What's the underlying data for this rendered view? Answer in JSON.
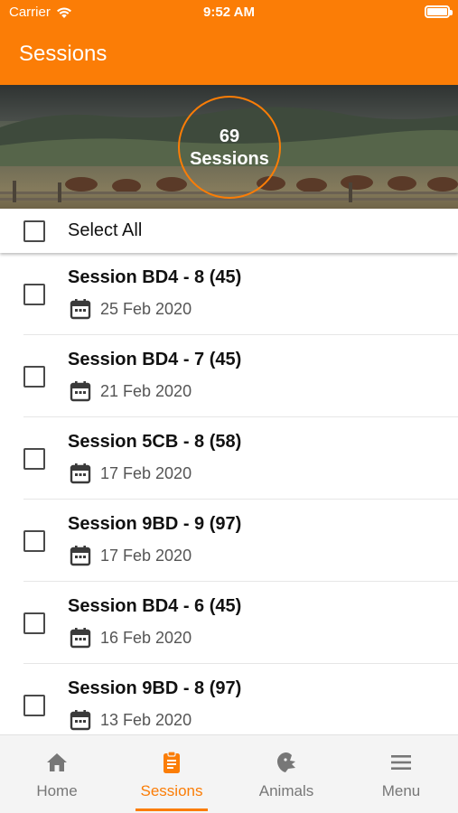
{
  "status_bar": {
    "carrier": "Carrier",
    "time": "9:52 AM"
  },
  "nav": {
    "title": "Sessions"
  },
  "banner": {
    "count": "69",
    "count_label": "Sessions"
  },
  "select_all": {
    "label": "Select All"
  },
  "sessions": [
    {
      "title": "Session BD4 - 8 (45)",
      "date": "25 Feb 2020"
    },
    {
      "title": "Session BD4 - 7 (45)",
      "date": "21 Feb 2020"
    },
    {
      "title": "Session 5CB - 8 (58)",
      "date": "17 Feb 2020"
    },
    {
      "title": "Session 9BD - 9 (97)",
      "date": "17 Feb 2020"
    },
    {
      "title": "Session BD4 - 6 (45)",
      "date": "16 Feb 2020"
    },
    {
      "title": "Session 9BD - 8 (97)",
      "date": "13 Feb 2020"
    }
  ],
  "tabs": [
    {
      "label": "Home",
      "icon": "home-icon",
      "active": false
    },
    {
      "label": "Sessions",
      "icon": "clipboard-icon",
      "active": true
    },
    {
      "label": "Animals",
      "icon": "animal-head-icon",
      "active": false
    },
    {
      "label": "Menu",
      "icon": "hamburger-menu-icon",
      "active": false
    }
  ],
  "colors": {
    "accent": "#fb7d06",
    "inactive_tab": "#777777"
  }
}
